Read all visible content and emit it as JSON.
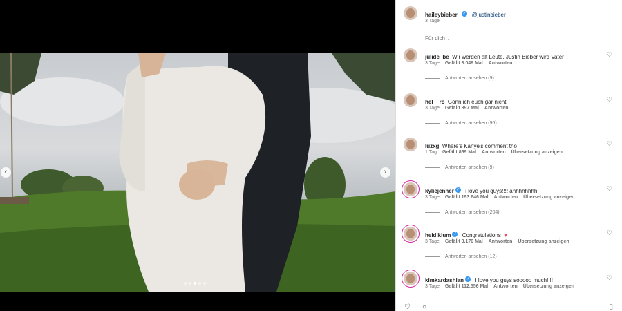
{
  "post": {
    "author": "haileybieber",
    "mention": "@justinbieber",
    "age": "3 Tage",
    "filter_label": "Für dich"
  },
  "carousel": {
    "prev_icon": "‹",
    "next_icon": "›",
    "slide_count": 5,
    "active_slide": 3
  },
  "comments": [
    {
      "user": "julide_be",
      "verified": false,
      "text": "Wir werden alt Leute, Justin Bieber wird Vater",
      "age": "3 Tage",
      "likes": "Gefällt 3.049 Mal",
      "reply": "Antworten",
      "translate": "",
      "replies": "Antworten ansehen (9)"
    },
    {
      "user": "hel__ro",
      "verified": false,
      "text": "Gönn ich euch gar nicht",
      "age": "3 Tage",
      "likes": "Gefällt 397 Mal",
      "reply": "Antworten",
      "translate": "",
      "replies": "Antworten ansehen (96)"
    },
    {
      "user": "luzxg",
      "verified": false,
      "text": "Where's Kanye's comment tho",
      "age": "1 Tag",
      "likes": "Gefällt 869 Mal",
      "reply": "Antworten",
      "translate": "Übersetzung anzeigen",
      "replies": "Antworten ansehen (9)"
    },
    {
      "user": "kyliejenner",
      "verified": true,
      "text": "i love you guys!!!! ahhhhhhhh",
      "age": "3 Tage",
      "likes": "Gefällt 193.646 Mal",
      "reply": "Antworten",
      "translate": "Übersetzung anzeigen",
      "replies": "Antworten ansehen (204)"
    },
    {
      "user": "heidiklum",
      "verified": true,
      "text": "Congratulations",
      "age": "3 Tage",
      "likes": "Gefällt 3.170 Mal",
      "reply": "Antworten",
      "translate": "Übersetzung anzeigen",
      "replies": "Antworten ansehen (12)"
    },
    {
      "user": "kimkardashian",
      "verified": true,
      "text": "I love you guys sooooo much!!!!",
      "age": "3 Tage",
      "likes": "Gefällt 112.556 Mal",
      "reply": "Antworten",
      "translate": "Übersetzung anzeigen",
      "replies": ""
    }
  ],
  "icons": {
    "heart": "♡",
    "red_heart": "♥",
    "verified": "✓",
    "chevron": "⌄"
  },
  "colors": {
    "verified": "#3897f0",
    "story_ring": "#d6249f",
    "red_heart": "#ed4956"
  }
}
